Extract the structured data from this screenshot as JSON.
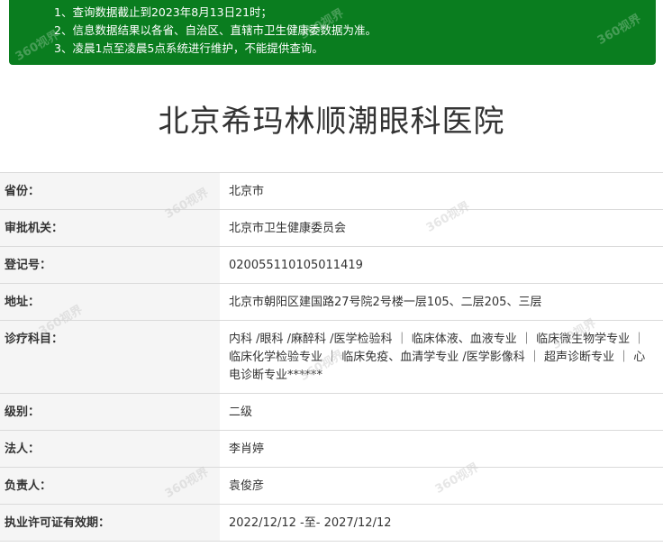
{
  "notice": {
    "lines": [
      "1、查询数据截止到2023年8月13日21时；",
      "2、信息数据结果以各省、自治区、直辖市卫生健康委数据为准。",
      "3、凌晨1点至凌晨5点系统进行维护，不能提供查询。"
    ]
  },
  "hospital": {
    "name": "北京希玛林顺潮眼科医院"
  },
  "fields": [
    {
      "label": "省份：",
      "value": "北京市"
    },
    {
      "label": "审批机关：",
      "value": "北京市卫生健康委员会"
    },
    {
      "label": "登记号：",
      "value": "020055110105011419"
    },
    {
      "label": "地址：",
      "value": "北京市朝阳区建国路27号院2号楼一层105、二层205、三层"
    },
    {
      "label": "诊疗科目：",
      "value": "内科 /眼科 /麻醉科 /医学检验科 ｜ 临床体液、血液专业 ｜ 临床微生物学专业 ｜ 临床化学检验专业 ｜ 临床免疫、血清学专业 /医学影像科 ｜ 超声诊断专业 ｜ 心电诊断专业******"
    },
    {
      "label": "级别：",
      "value": "二级"
    },
    {
      "label": "法人：",
      "value": "李肖婷"
    },
    {
      "label": "负责人：",
      "value": "袁俊彦"
    },
    {
      "label": "执业许可证有效期：",
      "value": "2022/12/12 -至- 2027/12/12"
    }
  ],
  "watermark": {
    "text": "360视界"
  },
  "colors": {
    "notice_bg": "#0a7d1f",
    "label_bg": "#f5f5f5",
    "border": "#dadada",
    "text": "#333333"
  }
}
